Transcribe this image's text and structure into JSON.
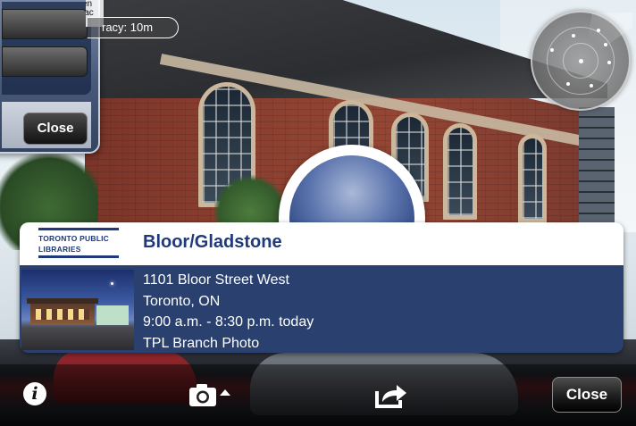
{
  "top_dialog": {
    "clipped_lines": [
      "en",
      "lac"
    ],
    "close_label": "Close"
  },
  "accuracy_label": "racy: 10m",
  "poi_card": {
    "logo_lines": [
      "TORONTO PUBLIC",
      "LIBRARIES"
    ],
    "title": "Bloor/Gladstone",
    "address": "1101 Bloor Street West",
    "city": "Toronto, ON",
    "hours": "9:00 a.m. - 8:30 p.m. today",
    "photo_label": "TPL Branch Photo"
  },
  "toolbar": {
    "info_icon": "info-icon",
    "camera_icon": "camera-icon",
    "share_icon": "share-icon",
    "close_label": "Close"
  },
  "colors": {
    "card_blue": "#2a4170",
    "title_blue": "#1f3a7a"
  }
}
